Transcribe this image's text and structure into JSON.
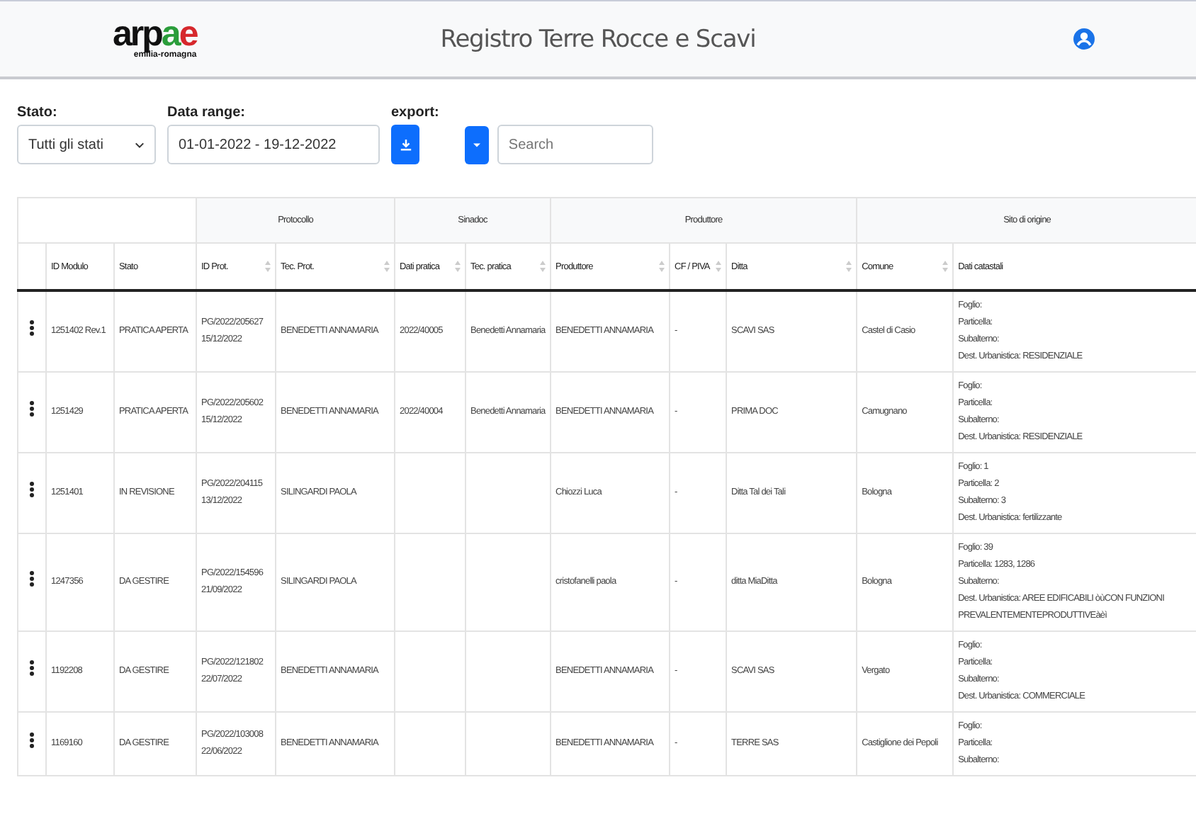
{
  "header": {
    "logo": "arpae",
    "logo_sub": "emilia-romagna",
    "title": "Registro Terre Rocce e Scavi"
  },
  "filters": {
    "stato": {
      "label": "Stato:",
      "value": "Tutti gli stati"
    },
    "date_range": {
      "label": "Data range:",
      "value": "01-01-2022 - 19-12-2022"
    },
    "export": {
      "label": "export:"
    },
    "search": {
      "placeholder": "Search"
    }
  },
  "table": {
    "groups": [
      {
        "label": "Protocollo"
      },
      {
        "label": "Sinadoc"
      },
      {
        "label": "Produttore"
      },
      {
        "label": "Sito di origine"
      }
    ],
    "columns": [
      {
        "sortable": false
      },
      {
        "label": "ID Modulo",
        "sortable": false
      },
      {
        "label": "Stato",
        "sortable": false
      },
      {
        "label": "ID Prot.",
        "sortable": true
      },
      {
        "label": "Tec. Prot.",
        "sortable": true
      },
      {
        "label": "Dati pratica",
        "sortable": true
      },
      {
        "label": "Tec. pratica",
        "sortable": true
      },
      {
        "label": "Produttore",
        "sortable": true
      },
      {
        "label": "CF / PIVA",
        "sortable": true
      },
      {
        "label": "Ditta",
        "sortable": true
      },
      {
        "label": "Comune",
        "sortable": true
      },
      {
        "label": "Dati catastali",
        "sortable": false
      }
    ],
    "rows": [
      {
        "id": "1251402 Rev.1",
        "stato": "PRATICA APERTA",
        "prot": [
          "PG/2022/205627",
          "15/12/2022"
        ],
        "tec_prot": "BENEDETTI ANNAMARIA",
        "dati_pratica": "2022/40005",
        "tec_pratica": "Benedetti Annamaria",
        "produttore": "BENEDETTI ANNAMARIA",
        "cf": "-",
        "ditta": "SCAVI SAS",
        "comune": "Castel di Casio",
        "catastali": [
          "Foglio:",
          "Particella:",
          "Subalterno:",
          "Dest. Urbanistica: RESIDENZIALE"
        ]
      },
      {
        "id": "1251429",
        "stato": "PRATICA APERTA",
        "prot": [
          "PG/2022/205602",
          "15/12/2022"
        ],
        "tec_prot": "BENEDETTI ANNAMARIA",
        "dati_pratica": "2022/40004",
        "tec_pratica": "Benedetti Annamaria",
        "produttore": "BENEDETTI ANNAMARIA",
        "cf": "-",
        "ditta": "PRIMA DOC",
        "comune": "Camugnano",
        "catastali": [
          "Foglio:",
          "Particella:",
          "Subalterno:",
          "Dest. Urbanistica: RESIDENZIALE"
        ]
      },
      {
        "id": "1251401",
        "stato": "IN REVISIONE",
        "prot": [
          "PG/2022/204115",
          "13/12/2022"
        ],
        "tec_prot": "SILINGARDI PAOLA",
        "dati_pratica": "",
        "tec_pratica": "",
        "produttore": "Chiozzi Luca",
        "cf": "-",
        "ditta": "Ditta Tal dei Tali",
        "comune": "Bologna",
        "catastali": [
          "Foglio: 1",
          "Particella: 2",
          "Subalterno: 3",
          "Dest. Urbanistica: fertilizzante"
        ]
      },
      {
        "id": "1247356",
        "stato": "DA GESTIRE",
        "prot": [
          "PG/2022/154596",
          "21/09/2022"
        ],
        "tec_prot": "SILINGARDI PAOLA",
        "dati_pratica": "",
        "tec_pratica": "",
        "produttore": "cristofanelli paola",
        "cf": "-",
        "ditta": "ditta MiaDitta",
        "comune": "Bologna",
        "catastali": [
          "Foglio: 39",
          "Particella: 1283, 1286",
          "Subalterno:",
          "Dest. Urbanistica: AREE EDIFICABILI òùCON FUNZIONI PREVALENTEMENTEPRODUTTIVEàèì"
        ]
      },
      {
        "id": "1192208",
        "stato": "DA GESTIRE",
        "prot": [
          "PG/2022/121802",
          "22/07/2022"
        ],
        "tec_prot": "BENEDETTI ANNAMARIA",
        "dati_pratica": "",
        "tec_pratica": "",
        "produttore": "BENEDETTI ANNAMARIA",
        "cf": "-",
        "ditta": "SCAVI SAS",
        "comune": "Vergato",
        "catastali": [
          "Foglio:",
          "Particella:",
          "Subalterno:",
          "Dest. Urbanistica: COMMERCIALE"
        ]
      },
      {
        "id": "1169160",
        "stato": "DA GESTIRE",
        "prot": [
          "PG/2022/103008",
          "22/06/2022"
        ],
        "tec_prot": "BENEDETTI ANNAMARIA",
        "dati_pratica": "",
        "tec_pratica": "",
        "produttore": "BENEDETTI ANNAMARIA",
        "cf": "-",
        "ditta": "TERRE SAS",
        "comune": "Castiglione dei Pepoli",
        "catastali": [
          "Foglio:",
          "Particella:",
          "Subalterno:"
        ]
      }
    ]
  }
}
